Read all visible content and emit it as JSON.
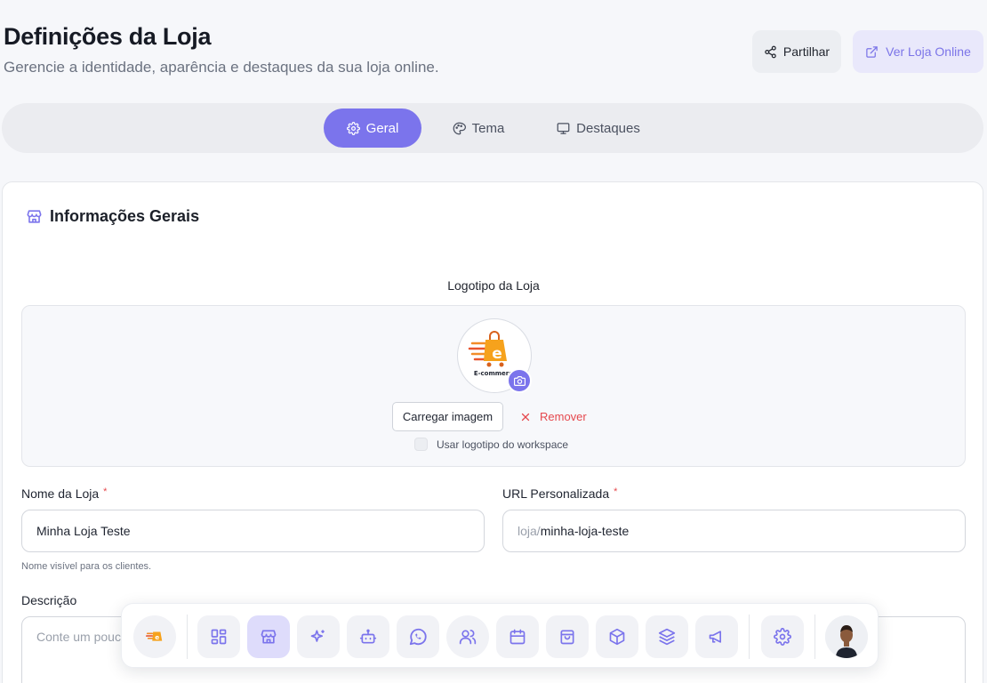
{
  "header": {
    "title": "Definições da Loja",
    "subtitle": "Gerencie a identidade, aparência e destaques da sua loja online.",
    "share_label": "Partilhar",
    "view_store_label": "Ver Loja Online"
  },
  "tabs": [
    {
      "label": "Geral",
      "icon": "gear-icon",
      "active": true
    },
    {
      "label": "Tema",
      "icon": "palette-icon",
      "active": false
    },
    {
      "label": "Destaques",
      "icon": "monitor-icon",
      "active": false
    }
  ],
  "general": {
    "section_title": "Informações Gerais",
    "logo": {
      "label": "Logotipo da Loja",
      "logo_text": "E-commerce",
      "upload_label": "Carregar imagem",
      "remove_label": "Remover",
      "use_workspace_logo_label": "Usar logotipo do workspace",
      "use_workspace_logo_checked": false
    },
    "store_name": {
      "label": "Nome da Loja",
      "required_mark": "*",
      "value": "Minha Loja Teste",
      "helper": "Nome visível para os clientes."
    },
    "custom_url": {
      "label": "URL Personalizada",
      "required_mark": "*",
      "prefix": "loja/",
      "value": "minha-loja-teste"
    },
    "description": {
      "label": "Descrição",
      "placeholder": "Conte um pouco"
    }
  },
  "dock": {
    "items": [
      {
        "icon": "store-logo-icon"
      },
      {
        "icon": "dashboard-icon"
      },
      {
        "icon": "store-icon",
        "active": true
      },
      {
        "icon": "sparkles-icon"
      },
      {
        "icon": "bot-icon"
      },
      {
        "icon": "whatsapp-icon"
      },
      {
        "icon": "users-icon"
      },
      {
        "icon": "calendar-icon"
      },
      {
        "icon": "shopping-bag-icon"
      },
      {
        "icon": "box-icon"
      },
      {
        "icon": "layers-icon"
      },
      {
        "icon": "megaphone-icon"
      },
      {
        "icon": "settings-icon"
      },
      {
        "icon": "user-avatar"
      }
    ]
  },
  "colors": {
    "accent": "#7b74ec",
    "accent_soft": "#e9e8fb",
    "danger": "#e5484d",
    "background": "#f6f7fa"
  }
}
